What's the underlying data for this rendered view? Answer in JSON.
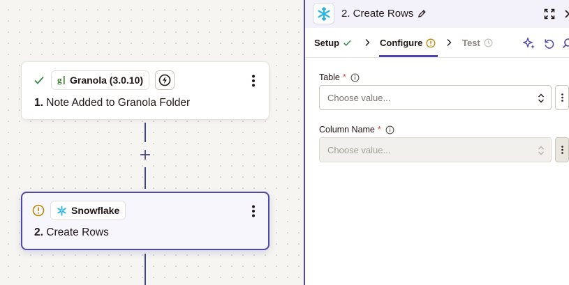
{
  "canvas": {
    "step1": {
      "status": "check-icon",
      "app_label": "Granola (3.0.10)",
      "number": "1.",
      "title": "Note Added to Granola Folder"
    },
    "add_step_icon": "plus-icon",
    "step2": {
      "status": "warning-icon",
      "app_label": "Snowflake",
      "number": "2.",
      "title": "Create Rows"
    }
  },
  "panel": {
    "title": "2. Create Rows",
    "tabs": [
      {
        "label": "Setup",
        "state": "complete"
      },
      {
        "label": "Configure",
        "state": "warning"
      },
      {
        "label": "Test",
        "state": "pending"
      }
    ],
    "fields": [
      {
        "label": "Table",
        "required_mark": "*",
        "placeholder": "Choose value...",
        "disabled": false
      },
      {
        "label": "Column Name",
        "required_mark": "*",
        "placeholder": "Choose value...",
        "disabled": true
      }
    ]
  },
  "colors": {
    "accent": "#5048a8",
    "success": "#2d8a3e",
    "warning": "#b88700",
    "snowflake": "#29b5e8",
    "granola": "#3a7d2a",
    "required": "#d8462c"
  }
}
